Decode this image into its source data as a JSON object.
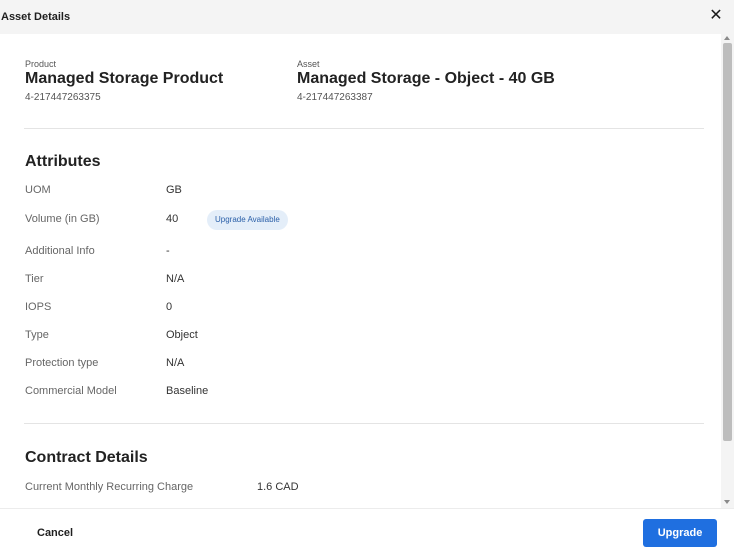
{
  "dialog": {
    "title": "Asset Details",
    "close_label": "✕"
  },
  "product": {
    "label": "Product",
    "name": "Managed Storage Product",
    "id": "4-217447263375"
  },
  "asset": {
    "label": "Asset",
    "name": "Managed Storage - Object - 40 GB",
    "id": "4-217447263387"
  },
  "attributes": {
    "title": "Attributes",
    "uom": {
      "label": "UOM",
      "value": "GB"
    },
    "volume": {
      "label": "Volume (in GB)",
      "value": "40",
      "badge": "Upgrade Available"
    },
    "additional_info": {
      "label": "Additional Info",
      "value": "-"
    },
    "tier": {
      "label": "Tier",
      "value": "N/A"
    },
    "iops": {
      "label": "IOPS",
      "value": "0"
    },
    "type": {
      "label": "Type",
      "value": "Object"
    },
    "protection_type": {
      "label": "Protection type",
      "value": "N/A"
    },
    "commercial_model": {
      "label": "Commercial Model",
      "value": "Baseline"
    }
  },
  "contract": {
    "title": "Contract Details",
    "mrc": {
      "label": "Current Monthly Recurring Charge",
      "value": "1.6 CAD"
    }
  },
  "footer": {
    "cancel_label": "Cancel",
    "upgrade_label": "Upgrade"
  },
  "colors": {
    "primary": "#1f6fe0",
    "badge_bg": "#e4eef9",
    "badge_text": "#2a5fa8"
  }
}
